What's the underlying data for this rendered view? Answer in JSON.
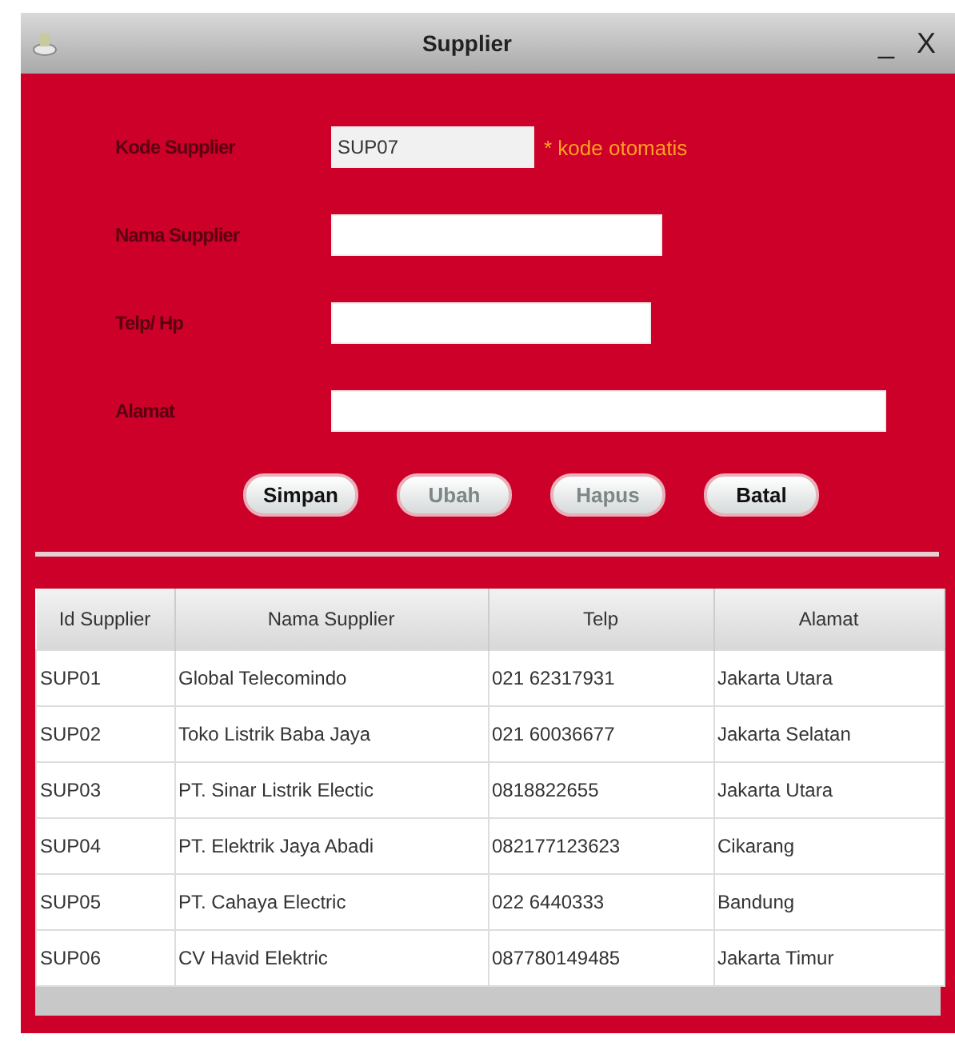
{
  "window": {
    "title": "Supplier",
    "minimize": "_",
    "close": "X"
  },
  "form": {
    "fields": [
      {
        "label": "Kode Supplier",
        "value": "SUP07",
        "disabled": true,
        "note": "* kode otomatis"
      },
      {
        "label": "Nama Supplier",
        "disabled": false
      },
      {
        "label": "Telp/ Hp",
        "disabled": false
      },
      {
        "label": "Alamat",
        "disabled": false
      }
    ],
    "buttons": [
      {
        "label": "Simpan",
        "disabled": false
      },
      {
        "label": "Ubah",
        "disabled": true
      },
      {
        "label": "Hapus",
        "disabled": true
      },
      {
        "label": "Batal",
        "disabled": false
      }
    ]
  },
  "table": {
    "columns": [
      "Id Supplier",
      "Nama Supplier",
      "Telp",
      "Alamat"
    ],
    "rows": [
      [
        "SUP01",
        "Global Telecomindo",
        "021 62317931",
        "Jakarta Utara"
      ],
      [
        "SUP02",
        "Toko Listrik Baba Jaya",
        "021 60036677",
        "Jakarta Selatan"
      ],
      [
        "SUP03",
        "PT. Sinar Listrik Electic",
        "0818822655",
        "Jakarta Utara"
      ],
      [
        "SUP04",
        "PT. Elektrik Jaya Abadi",
        "082177123623",
        "Cikarang"
      ],
      [
        "SUP05",
        "PT. Cahaya Electric",
        "022 6440333",
        "Bandung"
      ],
      [
        "SUP06",
        "CV Havid Elektric",
        "087780149485",
        "Jakarta Timur"
      ]
    ]
  }
}
